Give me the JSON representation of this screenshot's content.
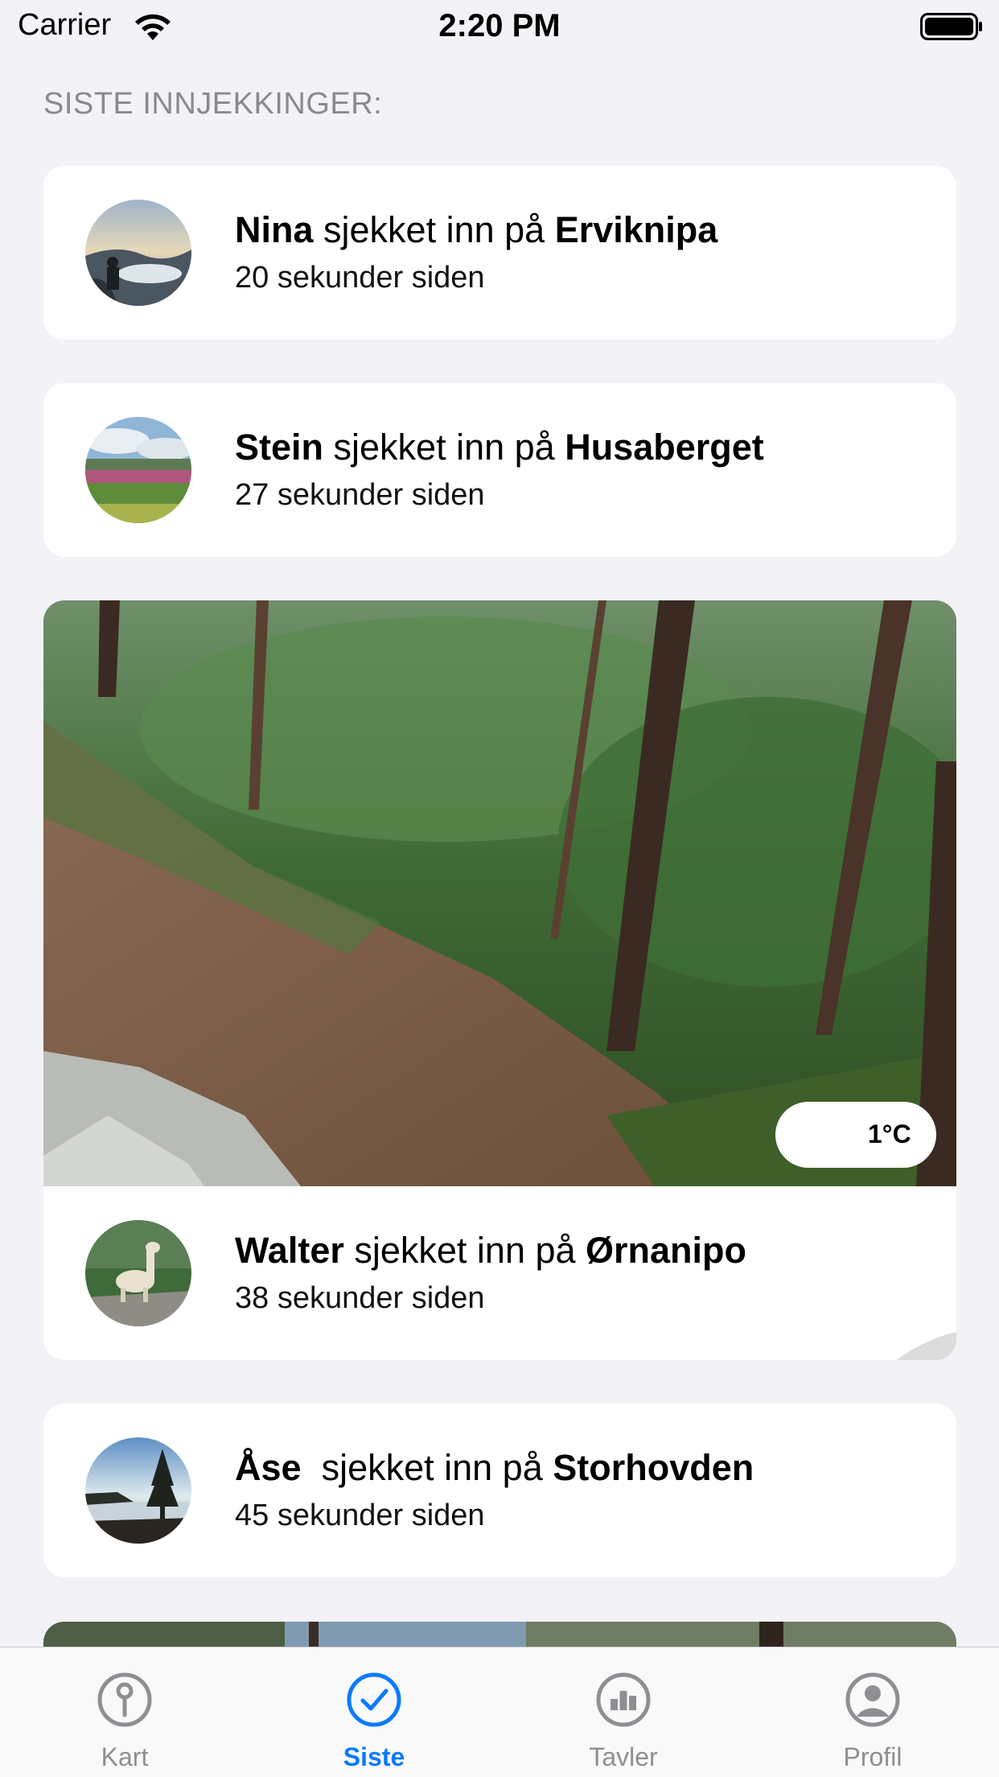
{
  "status_bar": {
    "carrier": "Carrier",
    "time": "2:20 PM"
  },
  "section_header": "SISTE INNJEKKINGER:",
  "checkins": [
    {
      "name": "Nina",
      "verb": " sjekket inn på ",
      "place": "Erviknipa",
      "time_ago": "20 sekunder siden"
    },
    {
      "name": "Stein",
      "verb": " sjekket inn på ",
      "place": "Husaberget",
      "time_ago": "27 sekunder siden"
    },
    {
      "name": "Walter",
      "verb": " sjekket inn på ",
      "place": "Ørnanipo",
      "time_ago": "38 sekunder siden",
      "weather": {
        "icon": "cloud-icon",
        "temperature": "1°C"
      }
    },
    {
      "name": "Åse",
      "verb": "  sjekket inn på ",
      "place": "Storhovden",
      "time_ago": "45 sekunder siden"
    }
  ],
  "tab_bar": {
    "active": "Siste",
    "tabs": [
      {
        "label": "Kart",
        "icon": "map-pin-icon"
      },
      {
        "label": "Siste",
        "icon": "checkmark-circle-icon"
      },
      {
        "label": "Tavler",
        "icon": "bar-chart-icon"
      },
      {
        "label": "Profil",
        "icon": "profile-icon"
      }
    ]
  },
  "colors": {
    "accent": "#0a7aff",
    "background": "#f2f2f7",
    "inactive_tab": "#8e8e93"
  }
}
